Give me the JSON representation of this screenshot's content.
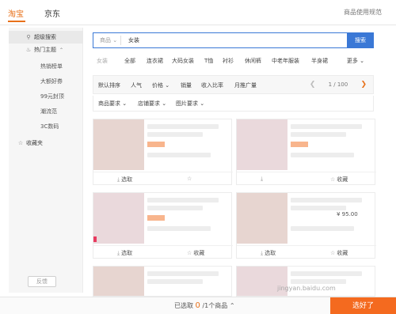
{
  "tabs": [
    "淘宝",
    "京东"
  ],
  "top_link": "商品使用规范",
  "sidebar": {
    "items": [
      {
        "label": "超级搜索",
        "icon": "search-icon"
      },
      {
        "label": "热门主题",
        "icon": "fire-icon"
      },
      {
        "label": "收藏夹",
        "icon": "star-icon"
      }
    ],
    "sub_items": [
      "热销榜单",
      "大额好券",
      "99元封顶",
      "潮流范",
      "3C数码"
    ],
    "feedback": "反馈"
  },
  "search": {
    "scope": "商品",
    "value": "女装",
    "button": "搜索"
  },
  "categories": [
    "女装",
    "全部",
    "连衣裙",
    "大码女装",
    "T恤",
    "衬衫",
    "休闲裤",
    "中老年服装",
    "半身裙"
  ],
  "more": "更多",
  "sort": [
    "默认排序",
    "人气",
    "价格",
    "销量",
    "收入比率",
    "月推广量"
  ],
  "pager": {
    "page": "1 / 100"
  },
  "filters": [
    "商品要求",
    "店铺要求",
    "图片要求"
  ],
  "card_actions": {
    "select": "选取",
    "fav": "收藏"
  },
  "price_sample": "¥ 95.00",
  "bottom": {
    "prefix": "已选取",
    "count": "0",
    "suffix": "/1个商品",
    "confirm": "选好了"
  },
  "watermark": "jingyan.baidu.com"
}
